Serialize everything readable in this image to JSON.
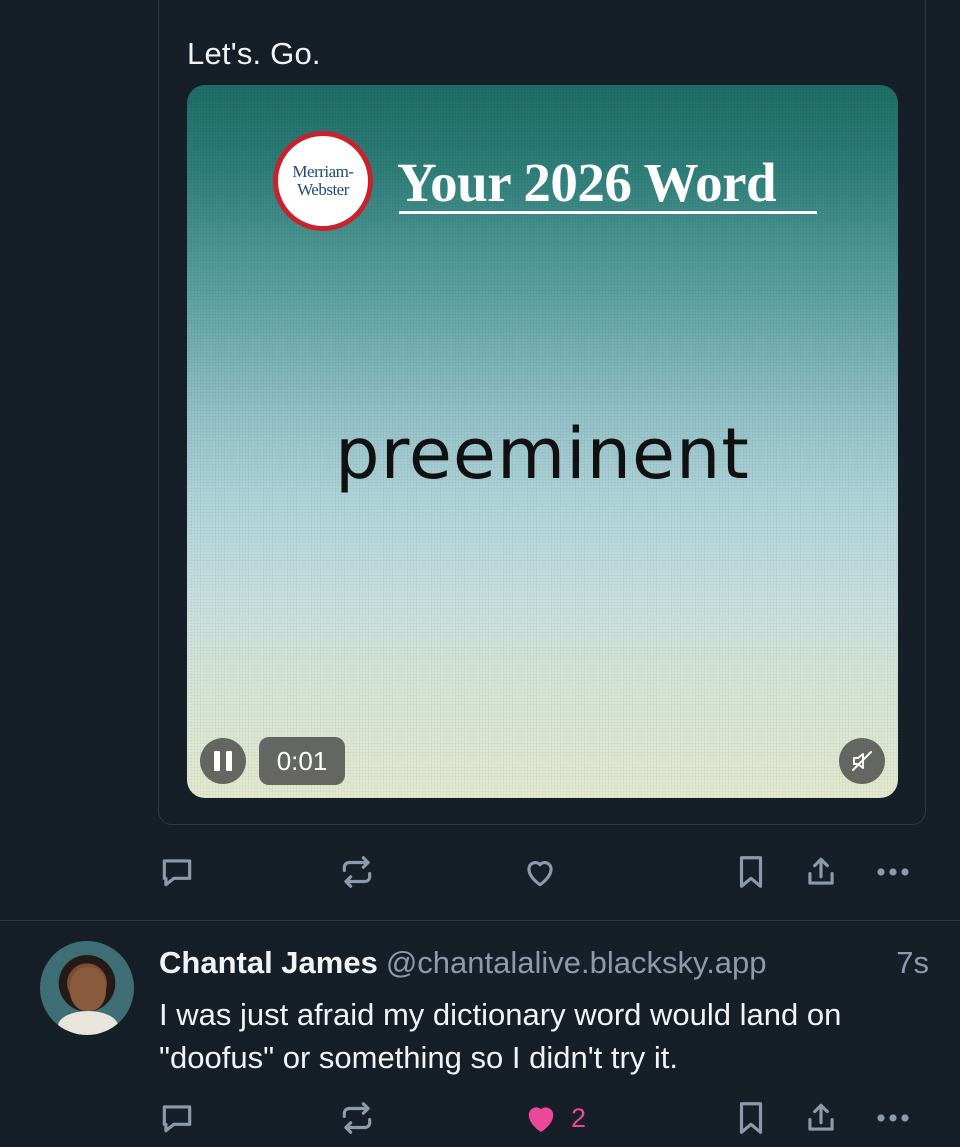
{
  "quoted_post": {
    "text": "Let's. Go.",
    "video": {
      "logo_line1": "Merriam-",
      "logo_line2": "Webster",
      "heading": "Your 2026 Word",
      "word": "preeminent",
      "time": "0:01",
      "playing": true,
      "muted": true
    }
  },
  "actions_top": {
    "like_count": ""
  },
  "post": {
    "author_name": "Chantal James",
    "handle": "@chantalalive.blacksky.app",
    "time": "7s",
    "text": "I was just afraid my dictionary word would land on \"doofus\" or something so I didn't try it."
  },
  "actions_bottom": {
    "like_count": "2",
    "liked": true,
    "like_color": "#ec4899"
  },
  "colors": {
    "background": "#161e27",
    "muted_text": "#8d9aab",
    "accent_like": "#ec4899"
  }
}
